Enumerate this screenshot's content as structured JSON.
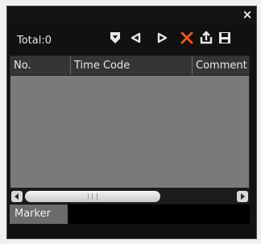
{
  "window": {
    "close_label": "×"
  },
  "toolbar": {
    "total_text": "Total:0",
    "buttons": [
      {
        "name": "add-marker",
        "icon": "marker-down-icon",
        "color": "#e6e6e6"
      },
      {
        "name": "previous-marker",
        "icon": "triangle-left-icon",
        "color": "#e6e6e6"
      },
      {
        "name": "next-marker",
        "icon": "triangle-right-icon",
        "color": "#e6e6e6"
      },
      {
        "name": "delete-marker",
        "icon": "delete-x-icon",
        "color": "#e8561e"
      },
      {
        "name": "export-marker",
        "icon": "export-icon",
        "color": "#e6e6e6"
      },
      {
        "name": "save-marker",
        "icon": "save-floppy-icon",
        "color": "#e6e6e6"
      }
    ]
  },
  "grid": {
    "columns": [
      "No.",
      "Time Code",
      "Comment"
    ],
    "rows": []
  },
  "scrollbar": {
    "left_arrow_icon": "arrow-left-icon",
    "right_arrow_icon": "arrow-right-icon"
  },
  "tabs": [
    {
      "label": "Marker",
      "active": true
    }
  ],
  "colors": {
    "panel_bg": "#111111",
    "grid_bg": "#7a7a7a",
    "header_bg": "#353535",
    "tab_bg": "#6b6b6b",
    "delete_accent": "#e8561e"
  }
}
